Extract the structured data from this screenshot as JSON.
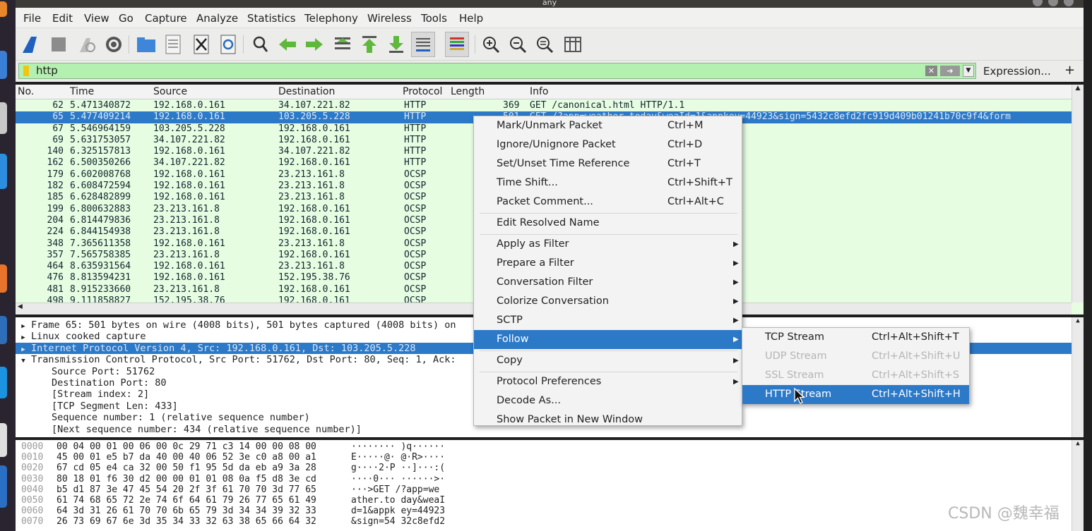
{
  "window": {
    "title": "any"
  },
  "menu": [
    "File",
    "Edit",
    "View",
    "Go",
    "Capture",
    "Analyze",
    "Statistics",
    "Telephony",
    "Wireless",
    "Tools",
    "Help"
  ],
  "toolbar": {
    "icons": [
      "shark-fin-icon",
      "stop-icon",
      "restart-icon",
      "options-gear-icon",
      "open-folder-icon",
      "save-file-icon",
      "close-file-icon",
      "reload-icon",
      "find-icon",
      "go-back-icon",
      "go-forward-icon",
      "go-to-packet-icon",
      "first-packet-icon",
      "last-packet-icon",
      "autoscroll-icon",
      "colorize-icon",
      "zoom-in-icon",
      "zoom-out-icon",
      "zoom-reset-icon",
      "resize-columns-icon"
    ]
  },
  "filter": {
    "value": "http",
    "expression_label": "Expression...",
    "add_label": "+"
  },
  "packet_list": {
    "columns": [
      "No.",
      "Time",
      "Source",
      "Destination",
      "Protocol",
      "Length",
      "Info"
    ],
    "rows": [
      {
        "no": "62",
        "time": "5.471340872",
        "src": "192.168.0.161",
        "dst": "34.107.221.82",
        "proto": "HTTP",
        "len": "369",
        "info": "GET /canonical.html HTTP/1.1",
        "selected": false
      },
      {
        "no": "65",
        "time": "5.477409214",
        "src": "192.168.0.161",
        "dst": "103.205.5.228",
        "proto": "HTTP",
        "len": "501",
        "info": "GET /?app=weather.today&weaId=1&appkey=44923&sign=5432c8efd2fc919d409b01241b70c9f4&form",
        "selected": true
      },
      {
        "no": "67",
        "time": "5.546964159",
        "src": "103.205.5.228",
        "dst": "192.168.0.161",
        "proto": "HTTP",
        "len": "",
        "info": "",
        "selected": false
      },
      {
        "no": "69",
        "time": "5.631753057",
        "src": "34.107.221.82",
        "dst": "192.168.0.161",
        "proto": "HTTP",
        "len": "",
        "info": "",
        "selected": false
      },
      {
        "no": "140",
        "time": "6.325157813",
        "src": "192.168.0.161",
        "dst": "34.107.221.82",
        "proto": "HTTP",
        "len": "",
        "info": "",
        "selected": false
      },
      {
        "no": "162",
        "time": "6.500350266",
        "src": "34.107.221.82",
        "dst": "192.168.0.161",
        "proto": "HTTP",
        "len": "",
        "info": "",
        "selected": false
      },
      {
        "no": "179",
        "time": "6.602008768",
        "src": "192.168.0.161",
        "dst": "23.213.161.8",
        "proto": "OCSP",
        "len": "",
        "info": "",
        "selected": false
      },
      {
        "no": "182",
        "time": "6.608472594",
        "src": "192.168.0.161",
        "dst": "23.213.161.8",
        "proto": "OCSP",
        "len": "",
        "info": "",
        "selected": false
      },
      {
        "no": "185",
        "time": "6.628482899",
        "src": "192.168.0.161",
        "dst": "23.213.161.8",
        "proto": "OCSP",
        "len": "",
        "info": "",
        "selected": false
      },
      {
        "no": "199",
        "time": "6.800632883",
        "src": "23.213.161.8",
        "dst": "192.168.0.161",
        "proto": "OCSP",
        "len": "",
        "info": "",
        "selected": false
      },
      {
        "no": "204",
        "time": "6.814479836",
        "src": "23.213.161.8",
        "dst": "192.168.0.161",
        "proto": "OCSP",
        "len": "",
        "info": "",
        "selected": false
      },
      {
        "no": "224",
        "time": "6.844154938",
        "src": "23.213.161.8",
        "dst": "192.168.0.161",
        "proto": "OCSP",
        "len": "",
        "info": "",
        "selected": false
      },
      {
        "no": "348",
        "time": "7.365611358",
        "src": "192.168.0.161",
        "dst": "23.213.161.8",
        "proto": "OCSP",
        "len": "",
        "info": "",
        "selected": false
      },
      {
        "no": "357",
        "time": "7.565758385",
        "src": "23.213.161.8",
        "dst": "192.168.0.161",
        "proto": "OCSP",
        "len": "",
        "info": "",
        "selected": false
      },
      {
        "no": "464",
        "time": "8.635931564",
        "src": "192.168.0.161",
        "dst": "23.213.161.8",
        "proto": "OCSP",
        "len": "",
        "info": "",
        "selected": false
      },
      {
        "no": "476",
        "time": "8.813594231",
        "src": "192.168.0.161",
        "dst": "152.195.38.76",
        "proto": "OCSP",
        "len": "",
        "info": "",
        "selected": false
      },
      {
        "no": "481",
        "time": "8.915233660",
        "src": "23.213.161.8",
        "dst": "192.168.0.161",
        "proto": "OCSP",
        "len": "",
        "info": "",
        "selected": false
      },
      {
        "no": "498",
        "time": "9.111858827",
        "src": "152.195.38.76",
        "dst": "192.168.0.161",
        "proto": "OCSP",
        "len": "",
        "info": "",
        "selected": false
      }
    ]
  },
  "details": [
    {
      "arrow": "▶",
      "text": "Frame 65: 501 bytes on wire (4008 bits), 501 bytes captured (4008 bits) on",
      "selected": false,
      "indent": 0
    },
    {
      "arrow": "▶",
      "text": "Linux cooked capture",
      "selected": false,
      "indent": 0
    },
    {
      "arrow": "▶",
      "text": "Internet Protocol Version 4, Src: 192.168.0.161, Dst: 103.205.5.228",
      "selected": true,
      "indent": 0
    },
    {
      "arrow": "▼",
      "text": "Transmission Control Protocol, Src Port: 51762, Dst Port: 80, Seq: 1, Ack:",
      "selected": false,
      "indent": 0
    },
    {
      "arrow": "",
      "text": "Source Port: 51762",
      "selected": false,
      "indent": 1
    },
    {
      "arrow": "",
      "text": "Destination Port: 80",
      "selected": false,
      "indent": 1
    },
    {
      "arrow": "",
      "text": "[Stream index: 2]",
      "selected": false,
      "indent": 1
    },
    {
      "arrow": "",
      "text": "[TCP Segment Len: 433]",
      "selected": false,
      "indent": 1
    },
    {
      "arrow": "",
      "text": "Sequence number: 1    (relative sequence number)",
      "selected": false,
      "indent": 1
    },
    {
      "arrow": "",
      "text": "[Next sequence number: 434    (relative sequence number)]",
      "selected": false,
      "indent": 1
    }
  ],
  "hex": [
    {
      "off": "0000",
      "hex": "00 04 00 01 00 06 00 0c  29 71 c3 14 00 00 08 00",
      "ascii": "········ )q······"
    },
    {
      "off": "0010",
      "hex": "45 00 01 e5 b7 da 40 00  40 06 52 3e c0 a8 00 a1",
      "ascii": "E·····@· @·R>····"
    },
    {
      "off": "0020",
      "hex": "67 cd 05 e4 ca 32 00 50  f1 95 5d da eb a9 3a 28",
      "ascii": "g····2·P ··]···:("
    },
    {
      "off": "0030",
      "hex": "80 18 01 f6 30 d2 00 00  01 01 08 0a f5 d8 3e cd",
      "ascii": "····0··· ······>·"
    },
    {
      "off": "0040",
      "hex": "b5 d1 87 3e 47 45 54 20  2f 3f 61 70 70 3d 77 65",
      "ascii": "···>GET  /?app=we"
    },
    {
      "off": "0050",
      "hex": "61 74 68 65 72 2e 74 6f  64 61 79 26 77 65 61 49",
      "ascii": "ather.to day&weaI"
    },
    {
      "off": "0060",
      "hex": "64 3d 31 26 61 70 70 6b  65 79 3d 34 34 39 32 33",
      "ascii": "d=1&appk ey=44923"
    },
    {
      "off": "0070",
      "hex": "26 73 69 67 6e 3d 35 34  33 32 63 38 65 66 64 32",
      "ascii": "&sign=54 32c8efd2"
    }
  ],
  "context_menu": {
    "items": [
      {
        "label": "Mark/Unmark Packet",
        "shortcut": "Ctrl+M",
        "submenu": false,
        "highlighted": false
      },
      {
        "label": "Ignore/Unignore Packet",
        "shortcut": "Ctrl+D",
        "submenu": false,
        "highlighted": false
      },
      {
        "label": "Set/Unset Time Reference",
        "shortcut": "Ctrl+T",
        "submenu": false,
        "highlighted": false
      },
      {
        "label": "Time Shift...",
        "shortcut": "Ctrl+Shift+T",
        "submenu": false,
        "highlighted": false
      },
      {
        "label": "Packet Comment...",
        "shortcut": "Ctrl+Alt+C",
        "submenu": false,
        "highlighted": false
      },
      {
        "sep": true
      },
      {
        "label": "Edit Resolved Name",
        "shortcut": "",
        "submenu": false,
        "highlighted": false
      },
      {
        "sep": true
      },
      {
        "label": "Apply as Filter",
        "shortcut": "",
        "submenu": true,
        "highlighted": false
      },
      {
        "label": "Prepare a Filter",
        "shortcut": "",
        "submenu": true,
        "highlighted": false
      },
      {
        "label": "Conversation Filter",
        "shortcut": "",
        "submenu": true,
        "highlighted": false
      },
      {
        "label": "Colorize Conversation",
        "shortcut": "",
        "submenu": true,
        "highlighted": false
      },
      {
        "label": "SCTP",
        "shortcut": "",
        "submenu": true,
        "highlighted": false
      },
      {
        "label": "Follow",
        "shortcut": "",
        "submenu": true,
        "highlighted": true
      },
      {
        "sep": true
      },
      {
        "label": "Copy",
        "shortcut": "",
        "submenu": true,
        "highlighted": false
      },
      {
        "sep": true
      },
      {
        "label": "Protocol Preferences",
        "shortcut": "",
        "submenu": true,
        "highlighted": false
      },
      {
        "label": "Decode As...",
        "shortcut": "",
        "submenu": false,
        "highlighted": false
      },
      {
        "label": "Show Packet in New Window",
        "shortcut": "",
        "submenu": false,
        "highlighted": false
      }
    ]
  },
  "follow_submenu": {
    "items": [
      {
        "label": "TCP Stream",
        "shortcut": "Ctrl+Alt+Shift+T",
        "disabled": false,
        "highlighted": false
      },
      {
        "label": "UDP Stream",
        "shortcut": "Ctrl+Alt+Shift+U",
        "disabled": true,
        "highlighted": false
      },
      {
        "label": "SSL Stream",
        "shortcut": "Ctrl+Alt+Shift+S",
        "disabled": true,
        "highlighted": false
      },
      {
        "label": "HTTP Stream",
        "shortcut": "Ctrl+Alt+Shift+H",
        "disabled": false,
        "highlighted": true
      }
    ]
  },
  "watermark": "CSDN @魏幸福",
  "colors": {
    "selection": "#2c79c8",
    "packet_bg": "#e6fde2",
    "filter_bg": "#b4f0b0"
  }
}
